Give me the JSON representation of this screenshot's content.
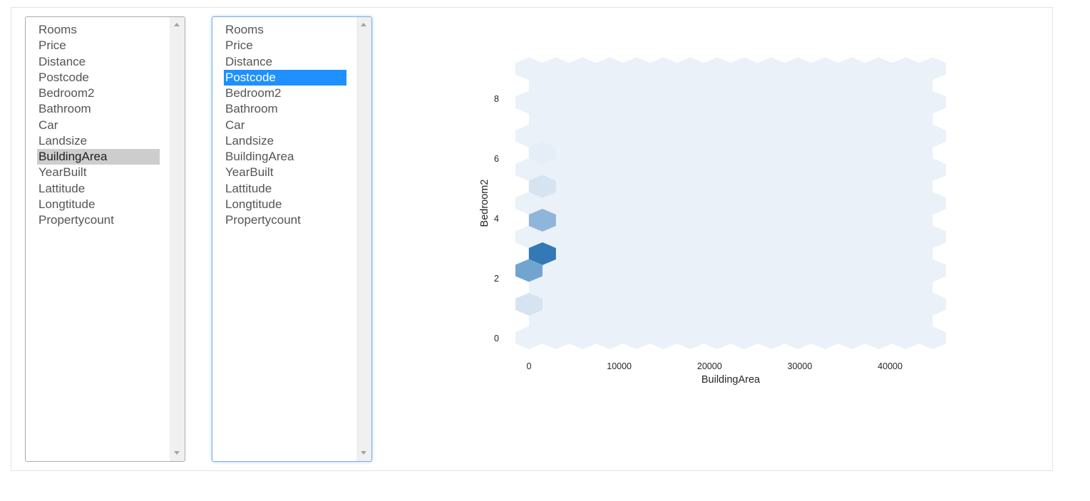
{
  "left_list": {
    "items": [
      "Rooms",
      "Price",
      "Distance",
      "Postcode",
      "Bedroom2",
      "Bathroom",
      "Car",
      "Landsize",
      "BuildingArea",
      "YearBuilt",
      "Lattitude",
      "Longtitude",
      "Propertycount"
    ],
    "selected": "BuildingArea"
  },
  "right_list": {
    "items": [
      "Rooms",
      "Price",
      "Distance",
      "Postcode",
      "Bedroom2",
      "Bathroom",
      "Car",
      "Landsize",
      "BuildingArea",
      "YearBuilt",
      "Lattitude",
      "Longtitude",
      "Propertycount"
    ],
    "selected": "Postcode"
  },
  "colors": {
    "selection_blue": "#1e90ff",
    "selection_gray": "#cdcdcd",
    "hex_base": "#eaf1f8"
  },
  "chart_data": {
    "type": "hexbin",
    "xlabel": "BuildingArea",
    "ylabel": "Bedroom2",
    "xticks": [
      "0",
      "10000",
      "20000",
      "30000",
      "40000"
    ],
    "xtick_values": [
      0,
      10000,
      20000,
      30000,
      40000
    ],
    "yticks": [
      "0",
      "2",
      "4",
      "6",
      "8"
    ],
    "ytick_values": [
      0,
      2,
      4,
      6,
      8
    ],
    "xlim": [
      -1500,
      46200
    ],
    "ylim": [
      -0.4,
      9.2
    ],
    "hex_spacing": {
      "x": 2980,
      "y": 0.562
    },
    "grid": false,
    "bins": [
      {
        "x": 1490,
        "y": 2.81,
        "color": "#3279b5"
      },
      {
        "x": 0,
        "y": 2.25,
        "color": "#71a5d0"
      },
      {
        "x": 1490,
        "y": 3.93,
        "color": "#8fb5da"
      },
      {
        "x": 1490,
        "y": 5.06,
        "color": "#d6e4f1"
      },
      {
        "x": 0,
        "y": 1.12,
        "color": "#d6e4f1"
      },
      {
        "x": 1490,
        "y": 6.18,
        "color": "#e5eef7"
      }
    ]
  }
}
